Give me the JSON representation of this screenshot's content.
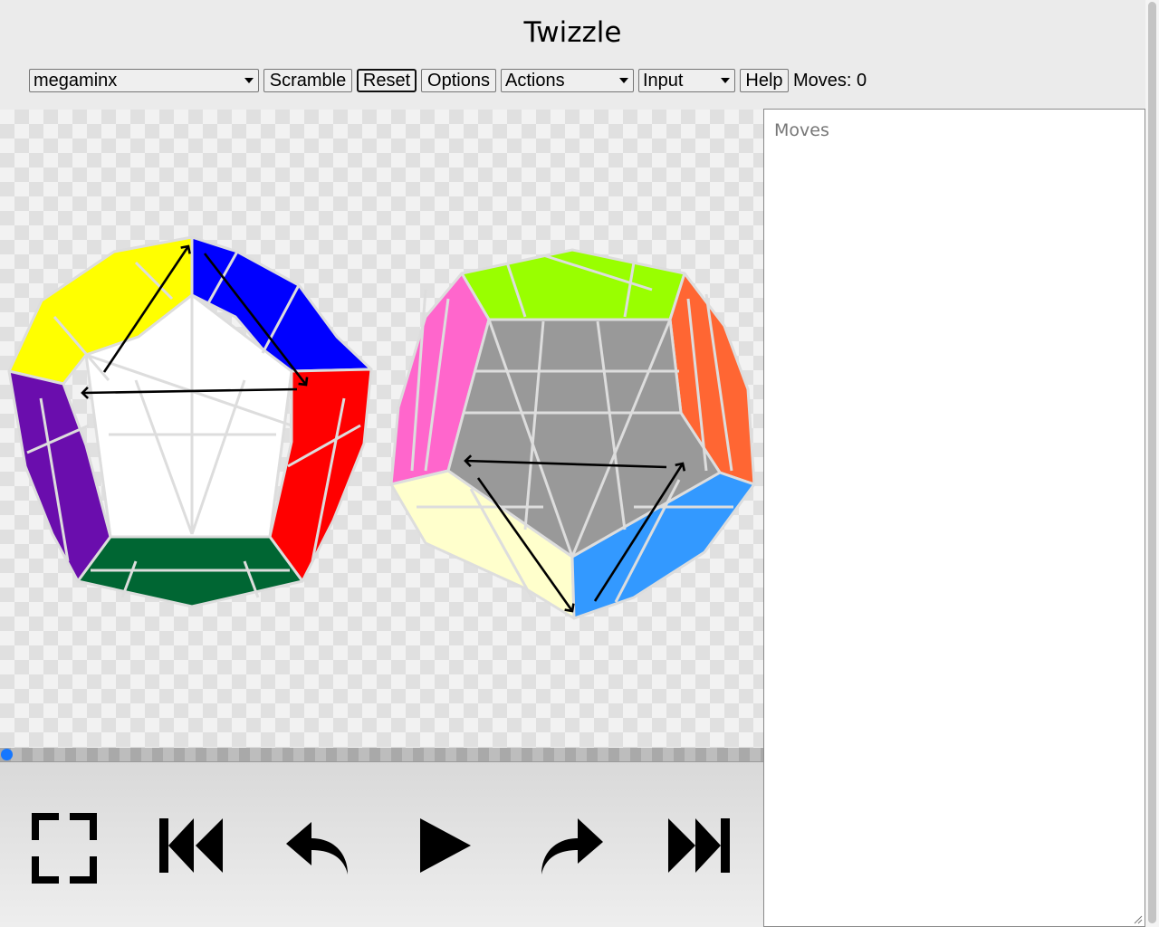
{
  "app": {
    "title": "Twizzle"
  },
  "toolbar": {
    "puzzle_select": {
      "value": "megaminx"
    },
    "scramble_label": "Scramble",
    "reset_label": "Reset",
    "options_label": "Options",
    "actions_select": {
      "value": "Actions"
    },
    "input_select": {
      "value": "Input"
    },
    "help_label": "Help",
    "moves_count": "Moves: 0"
  },
  "moves_panel": {
    "placeholder": "Moves"
  },
  "player": {
    "progress": 0,
    "buttons": [
      {
        "name": "fullscreen",
        "icon": "fullscreen-icon"
      },
      {
        "name": "skip-to-start",
        "icon": "skip-to-start-icon"
      },
      {
        "name": "step-backward",
        "icon": "undo-arrow-icon"
      },
      {
        "name": "play",
        "icon": "play-icon"
      },
      {
        "name": "step-forward",
        "icon": "redo-arrow-icon"
      },
      {
        "name": "skip-to-end",
        "icon": "skip-to-end-icon"
      }
    ]
  },
  "puzzle_colors": {
    "white": "#ffffff",
    "yellow": "#ffff00",
    "blue": "#0000ff",
    "purple": "#6a0dad",
    "red": "#ff0000",
    "dark-green": "#006633",
    "lime": "#99ff00",
    "pink": "#ff66cc",
    "orange": "#ff6633",
    "gray": "#999999",
    "cream": "#ffffcc",
    "light-blue": "#3399ff"
  }
}
